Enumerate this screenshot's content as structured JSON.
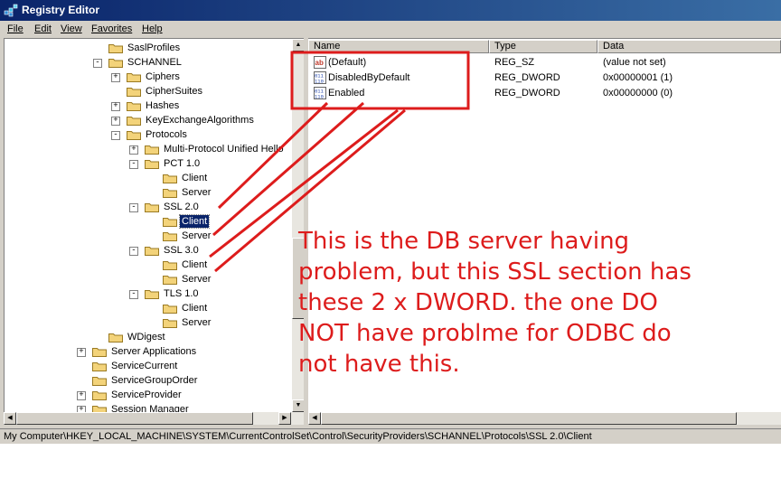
{
  "window": {
    "title": "Registry Editor"
  },
  "menu": {
    "items": [
      "File",
      "Edit",
      "View",
      "Favorites",
      "Help"
    ]
  },
  "tree": {
    "nodes": [
      {
        "label": "SaslProfiles",
        "expander": ""
      },
      {
        "label": "SCHANNEL",
        "expander": "-"
      },
      {
        "label": "Ciphers",
        "expander": "+"
      },
      {
        "label": "CipherSuites",
        "expander": ""
      },
      {
        "label": "Hashes",
        "expander": "+"
      },
      {
        "label": "KeyExchangeAlgorithms",
        "expander": "+"
      },
      {
        "label": "Protocols",
        "expander": "-"
      },
      {
        "label": "Multi-Protocol Unified Hello",
        "expander": "+"
      },
      {
        "label": "PCT 1.0",
        "expander": "-"
      },
      {
        "label": "Client",
        "expander": ""
      },
      {
        "label": "Server",
        "expander": ""
      },
      {
        "label": "SSL 2.0",
        "expander": "-"
      },
      {
        "label": "Client",
        "expander": ""
      },
      {
        "label": "Server",
        "expander": ""
      },
      {
        "label": "SSL 3.0",
        "expander": "-"
      },
      {
        "label": "Client",
        "expander": ""
      },
      {
        "label": "Server",
        "expander": ""
      },
      {
        "label": "TLS 1.0",
        "expander": "-"
      },
      {
        "label": "Client",
        "expander": ""
      },
      {
        "label": "Server",
        "expander": ""
      },
      {
        "label": "WDigest",
        "expander": ""
      },
      {
        "label": "Server Applications",
        "expander": "+"
      },
      {
        "label": "ServiceCurrent",
        "expander": ""
      },
      {
        "label": "ServiceGroupOrder",
        "expander": ""
      },
      {
        "label": "ServiceProvider",
        "expander": "+"
      },
      {
        "label": "Session Manager",
        "expander": "+"
      }
    ],
    "selected_label": "Client"
  },
  "list": {
    "headers": [
      "Name",
      "Type",
      "Data"
    ],
    "rows": [
      {
        "icon": "string-value-icon",
        "name": "(Default)",
        "type": "REG_SZ",
        "data": "(value not set)"
      },
      {
        "icon": "dword-value-icon",
        "name": "DisabledByDefault",
        "type": "REG_DWORD",
        "data": "0x00000001 (1)"
      },
      {
        "icon": "dword-value-icon",
        "name": "Enabled",
        "type": "REG_DWORD",
        "data": "0x00000000 (0)"
      }
    ]
  },
  "status": {
    "path": "My Computer\\HKEY_LOCAL_MACHINE\\SYSTEM\\CurrentControlSet\\Control\\SecurityProviders\\SCHANNEL\\Protocols\\SSL 2.0\\Client"
  },
  "annotation": {
    "text": "This is the DB server having\nproblem, but this SSL section has\nthese 2 x DWORD. the one DO\nNOT have problme for ODBC do\nnot have this.",
    "color": "#dd1c1c"
  },
  "colors": {
    "title_bar": "#0a246a",
    "selection": "#0a246a",
    "annotation": "#dd1c1c"
  }
}
